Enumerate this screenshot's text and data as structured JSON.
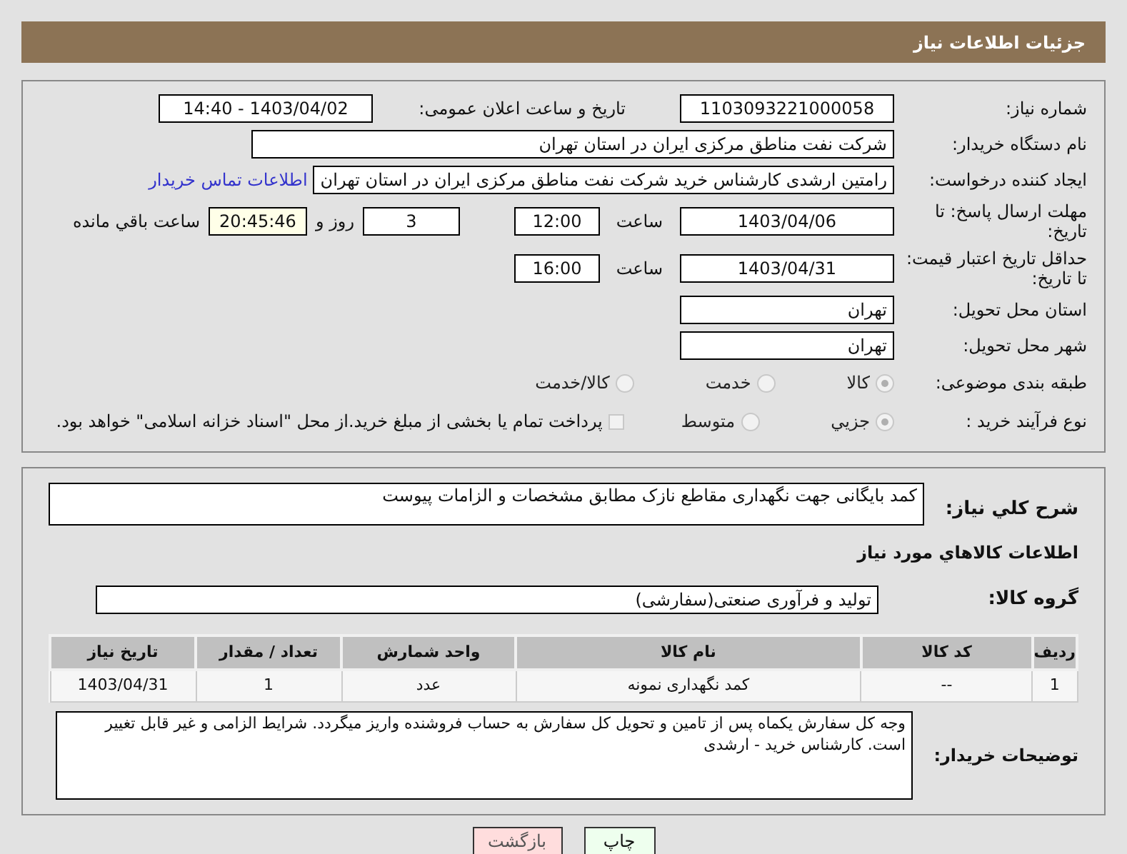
{
  "header": {
    "title": "جزئیات اطلاعات نیاز"
  },
  "need_number": {
    "label": "شماره نیاز:",
    "value": "1103093221000058"
  },
  "announce": {
    "label": "تاریخ و ساعت اعلان عمومی:",
    "value": "1403/04/02 - 14:40"
  },
  "buyer_org": {
    "label": "نام دستگاه خریدار:",
    "value": "شرکت نفت مناطق مرکزی ایران در استان تهران"
  },
  "requester": {
    "label": "ایجاد کننده درخواست:",
    "value": "رامتین ارشدی کارشناس خرید شرکت نفت مناطق مرکزی ایران در استان تهران",
    "link": "اطلاعات تماس خریدار"
  },
  "deadline": {
    "label": "مهلت ارسال پاسخ: تا تاریخ:",
    "date": "1403/04/06",
    "time_label": "ساعت",
    "time": "12:00",
    "days": "3",
    "days_label": "روز و",
    "remaining": "20:45:46",
    "remaining_label": "ساعت باقي مانده"
  },
  "price_validity": {
    "label": "حداقل تاریخ اعتبار قیمت: تا تاریخ:",
    "date": "1403/04/31",
    "time_label": "ساعت",
    "time": "16:00"
  },
  "province": {
    "label": "استان محل تحویل:",
    "value": "تهران"
  },
  "city": {
    "label": "شهر محل تحویل:",
    "value": "تهران"
  },
  "category": {
    "label": "طبقه بندی موضوعی:",
    "options": [
      {
        "label": "کالا",
        "selected": true
      },
      {
        "label": "خدمت",
        "selected": false
      },
      {
        "label": "کالا/خدمت",
        "selected": false
      }
    ]
  },
  "process": {
    "label": "نوع فرآیند خرید :",
    "options": [
      {
        "label": "جزیي",
        "selected": true
      },
      {
        "label": "متوسط",
        "selected": false
      }
    ],
    "treasury": {
      "label": "پرداخت تمام یا بخشی از مبلغ خرید.از محل \"اسناد خزانه اسلامی\" خواهد بود.",
      "checked": false
    }
  },
  "description": {
    "label": "شرح کلي نیاز:",
    "value": "کمد بایگانی جهت نگهداری مقاطع نازک مطابق مشخصات و الزامات پیوست"
  },
  "items_heading": "اطلاعات کالاهاي مورد نیاز",
  "goods_group": {
    "label": "گروه کالا:",
    "value": "تولید و فرآوری صنعتی(سفارشی)"
  },
  "table": {
    "columns": [
      "ردیف",
      "کد کالا",
      "نام کالا",
      "واحد شمارش",
      "تعداد / مقدار",
      "تاریخ نیاز"
    ],
    "rows": [
      [
        "1",
        "--",
        "کمد نگهداری نمونه",
        "عدد",
        "1",
        "1403/04/31"
      ]
    ]
  },
  "buyer_notes": {
    "label": "توضیحات خریدار:",
    "value": "وجه کل سفارش یکماه پس از تامین و تحویل کل سفارش به حساب فروشنده واریز میگردد. شرایط الزامی و غیر قابل تغییر است. کارشناس خرید - ارشدی"
  },
  "buttons": [
    {
      "label": "چاپ",
      "kind": "print"
    },
    {
      "label": "بازگشت",
      "kind": "back"
    }
  ]
}
